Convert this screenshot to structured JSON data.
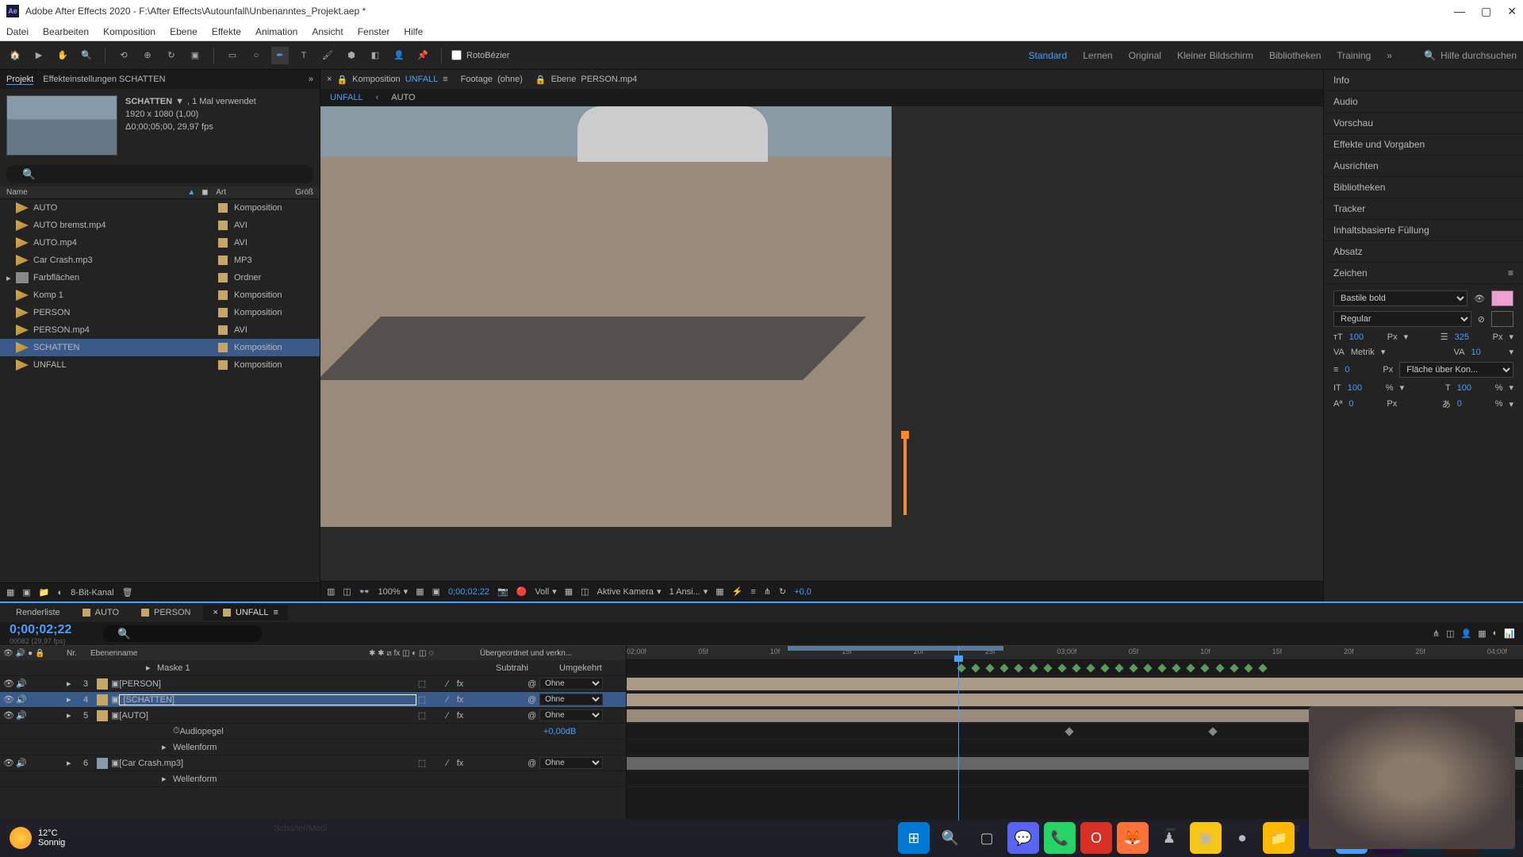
{
  "titlebar": {
    "app_logo": "Ae",
    "title": "Adobe After Effects 2020 - F:\\After Effects\\Autounfall\\Unbenanntes_Projekt.aep *"
  },
  "menubar": [
    "Datei",
    "Bearbeiten",
    "Komposition",
    "Ebene",
    "Effekte",
    "Animation",
    "Ansicht",
    "Fenster",
    "Hilfe"
  ],
  "toolbar": {
    "rotobezier": "RotoBézier",
    "workspaces": [
      "Standard",
      "Lernen",
      "Original",
      "Kleiner Bildschirm",
      "Bibliotheken",
      "Training"
    ],
    "search_placeholder": "Hilfe durchsuchen"
  },
  "project": {
    "tab_project": "Projekt",
    "tab_effects": "Effekteinstellungen SCHATTEN",
    "selected_name": "SCHATTEN",
    "selected_usage": ", 1 Mal verwendet",
    "selected_dims": "1920 x 1080 (1,00)",
    "selected_dur": "Δ0;00;05;00, 29,97 fps",
    "col_name": "Name",
    "col_type": "Art",
    "col_size": "Größ",
    "items": [
      {
        "name": "AUTO",
        "type": "Komposition",
        "icon": "comp",
        "color": "#c8a566"
      },
      {
        "name": "AUTO bremst.mp4",
        "type": "AVI",
        "icon": "footage",
        "color": "#c8a566"
      },
      {
        "name": "AUTO.mp4",
        "type": "AVI",
        "icon": "footage",
        "color": "#c8a566"
      },
      {
        "name": "Car Crash.mp3",
        "type": "MP3",
        "icon": "footage",
        "color": "#c8a566"
      },
      {
        "name": "Farbflächen",
        "type": "Ordner",
        "icon": "folder",
        "color": "#c8a566"
      },
      {
        "name": "Komp 1",
        "type": "Komposition",
        "icon": "comp",
        "color": "#c8a566"
      },
      {
        "name": "PERSON",
        "type": "Komposition",
        "icon": "comp",
        "color": "#c8a566"
      },
      {
        "name": "PERSON.mp4",
        "type": "AVI",
        "icon": "footage",
        "color": "#c8a566"
      },
      {
        "name": "SCHATTEN",
        "type": "Komposition",
        "icon": "comp",
        "color": "#c8a566",
        "selected": true
      },
      {
        "name": "UNFALL",
        "type": "Komposition",
        "icon": "comp",
        "color": "#c8a566"
      }
    ],
    "footer_bpc": "8-Bit-Kanal"
  },
  "composition": {
    "tab_comp": "Komposition",
    "tab_comp_name": "UNFALL",
    "tab_footage": "Footage",
    "tab_footage_name": "(ohne)",
    "tab_layer": "Ebene",
    "tab_layer_name": "PERSON.mp4",
    "breadcrumb": [
      "UNFALL",
      "AUTO"
    ],
    "viewer": {
      "zoom": "100%",
      "timecode": "0;00;02;22",
      "resolution": "Voll",
      "camera": "Aktive Kamera",
      "views": "1 Ansi...",
      "exposure": "+0,0"
    }
  },
  "right_panels": [
    "Info",
    "Audio",
    "Vorschau",
    "Effekte und Vorgaben",
    "Ausrichten",
    "Bibliotheken",
    "Tracker",
    "Inhaltsbasierte Füllung",
    "Absatz"
  ],
  "character": {
    "title": "Zeichen",
    "font": "Bastile bold",
    "style": "Regular",
    "size": "100",
    "size_unit": "Px",
    "leading": "325",
    "leading_unit": "Px",
    "kerning": "Metrik",
    "tracking": "10",
    "stroke": "0",
    "stroke_unit": "Px",
    "stroke_mode": "Fläche über Kon...",
    "vscale": "100",
    "vscale_unit": "%",
    "hscale": "100",
    "hscale_unit": "%",
    "baseline": "0",
    "baseline_unit": "Px",
    "tsume": "0",
    "tsume_unit": "%"
  },
  "timeline": {
    "tabs": [
      {
        "name": "Renderliste",
        "color": null
      },
      {
        "name": "AUTO",
        "color": "#c8a566"
      },
      {
        "name": "PERSON",
        "color": "#c8a566"
      },
      {
        "name": "UNFALL",
        "color": "#c8a566",
        "active": true
      }
    ],
    "timecode": "0;00;02;22",
    "frames": "00082 (29,97 fps)",
    "col_nr": "Nr.",
    "col_name": "Ebenenname",
    "col_mode_1": "Subtrahi",
    "col_mode_2": "Umgekehrt",
    "col_parent": "Übergeordnet und verkn...",
    "ruler_ticks": [
      "02;00f",
      "05f",
      "10f",
      "15f",
      "20f",
      "25f",
      "03;00f",
      "05f",
      "10f",
      "15f",
      "20f",
      "25f",
      "04;00f"
    ],
    "layers": [
      {
        "num": "",
        "name": "Maske 1",
        "mode1": "Subtrahi",
        "mode2": "Umgekehrt",
        "parent": "",
        "indent": 1,
        "sub": true
      },
      {
        "num": "3",
        "name": "[PERSON]",
        "parent": "Ohne",
        "color": "#c8a566"
      },
      {
        "num": "4",
        "name": "[SCHATTEN]",
        "parent": "Ohne",
        "color": "#c8a566",
        "selected": true
      },
      {
        "num": "5",
        "name": "[AUTO]",
        "parent": "Ohne",
        "color": "#c8a566"
      },
      {
        "num": "",
        "name": "Audiopegel",
        "value": "+0,00dB",
        "indent": 2,
        "sub": true
      },
      {
        "num": "",
        "name": "Wellenform",
        "indent": 2,
        "sub": true
      },
      {
        "num": "6",
        "name": "[Car Crash.mp3]",
        "parent": "Ohne",
        "color": "#8899aa"
      },
      {
        "num": "",
        "name": "Wellenform",
        "indent": 2,
        "sub": true
      }
    ],
    "footer_label": "Schalter/Modi"
  },
  "taskbar": {
    "temp": "12°C",
    "condition": "Sonnig"
  }
}
